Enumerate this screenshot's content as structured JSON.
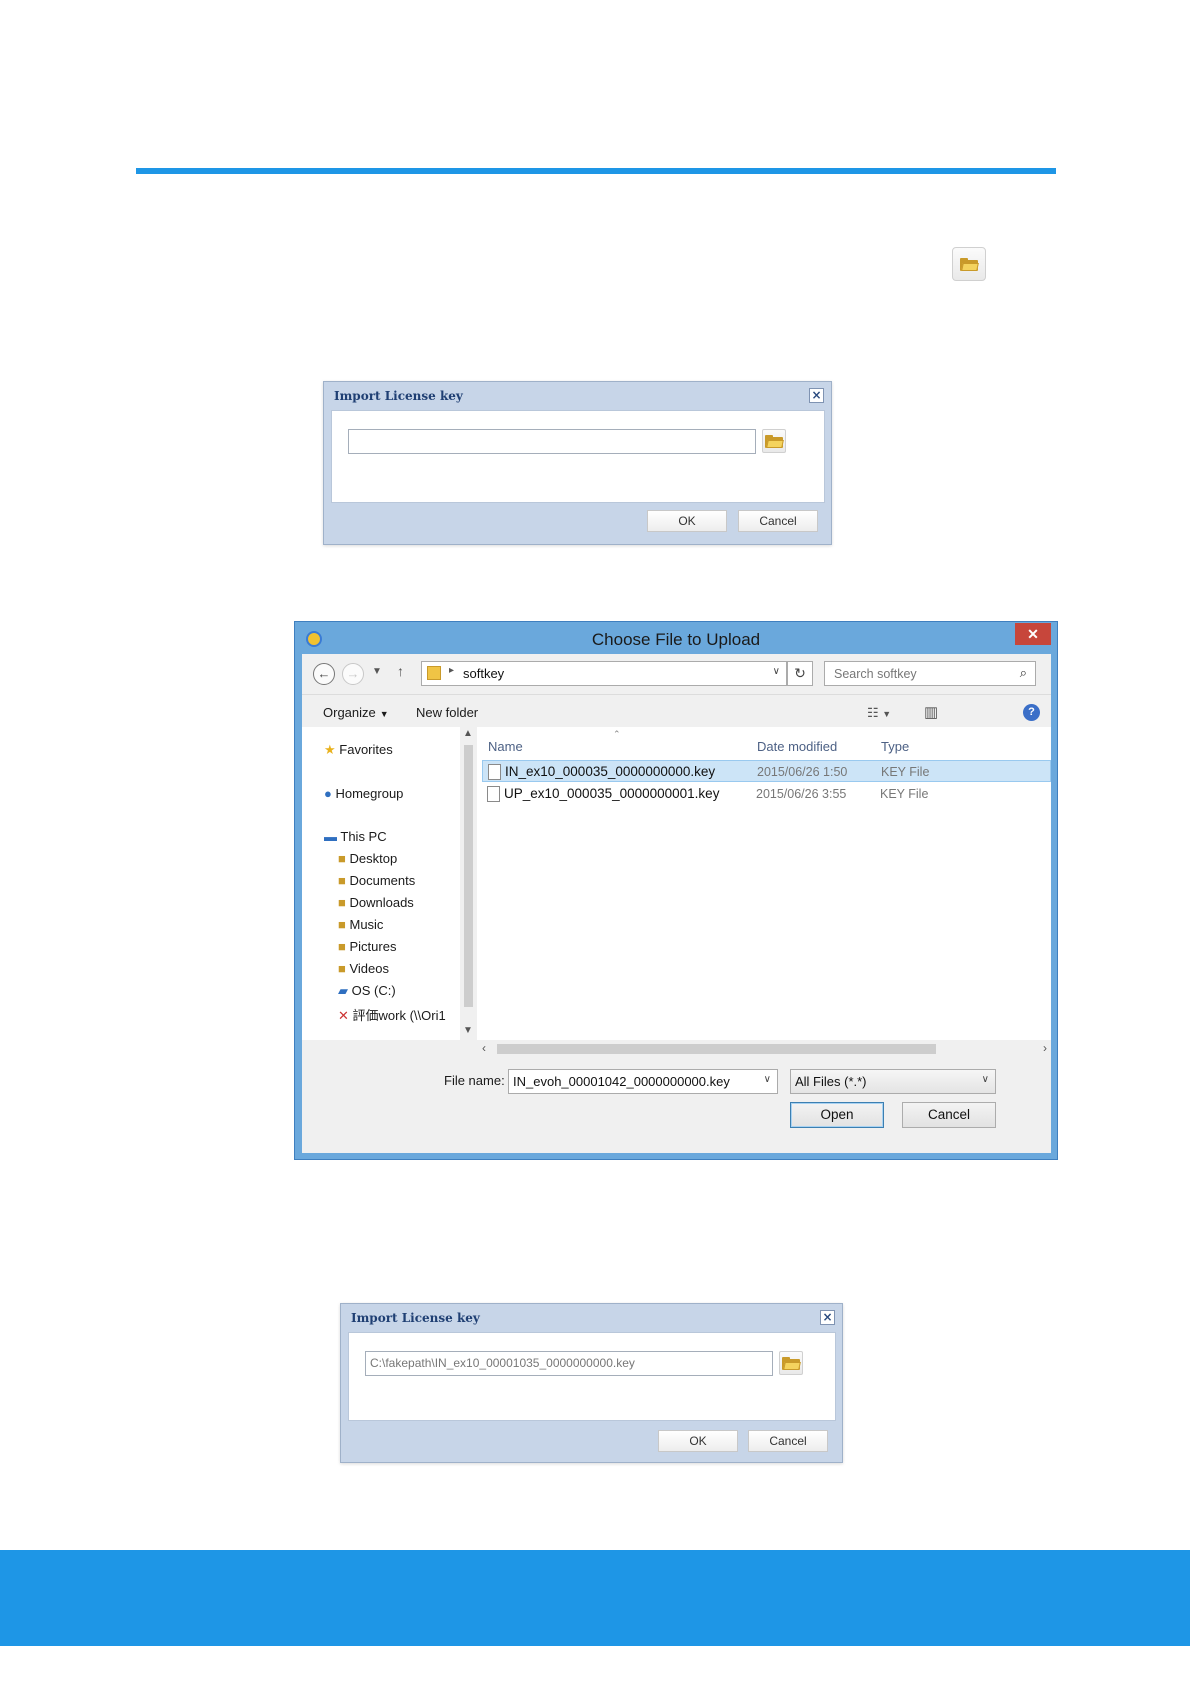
{
  "dialog1": {
    "title": "Import License key",
    "close": "×",
    "path_value": "",
    "ok": "OK",
    "cancel": "Cancel"
  },
  "file_dialog": {
    "title": "Choose File to Upload",
    "close": "✕",
    "address_folder": "softkey",
    "search_placeholder": "Search softkey",
    "organize": "Organize",
    "new_folder": "New folder",
    "nav_items": {
      "favorites": "Favorites",
      "homegroup": "Homegroup",
      "this_pc": "This PC",
      "desktop": "Desktop",
      "documents": "Documents",
      "downloads": "Downloads",
      "music": "Music",
      "pictures": "Pictures",
      "videos": "Videos",
      "os_c": "OS (C:)",
      "network": "評価work (\\\\Ori1"
    },
    "columns": {
      "name": "Name",
      "date": "Date modified",
      "type": "Type"
    },
    "files": [
      {
        "name": "IN_ex10_000035_0000000000.key",
        "date": "2015/06/26 1:50",
        "type": "KEY File",
        "selected": true
      },
      {
        "name": "UP_ex10_000035_0000000001.key",
        "date": "2015/06/26 3:55",
        "type": "KEY File",
        "selected": false
      }
    ],
    "file_name_label": "File name:",
    "file_name_value": "IN_evoh_00001042_0000000000.key",
    "file_type_value": "All Files (*.*)",
    "open": "Open",
    "cancel": "Cancel"
  },
  "dialog2": {
    "title": "Import License key",
    "close": "×",
    "path_value": "C:\\fakepath\\IN_ex10_00001035_0000000000.key",
    "ok": "OK",
    "cancel": "Cancel"
  },
  "colors": {
    "accent_rule": "#1e96e6",
    "dialog_frame": "#c7d5e8",
    "window_frame": "#6aa8dc",
    "selection": "#cce4f7"
  }
}
